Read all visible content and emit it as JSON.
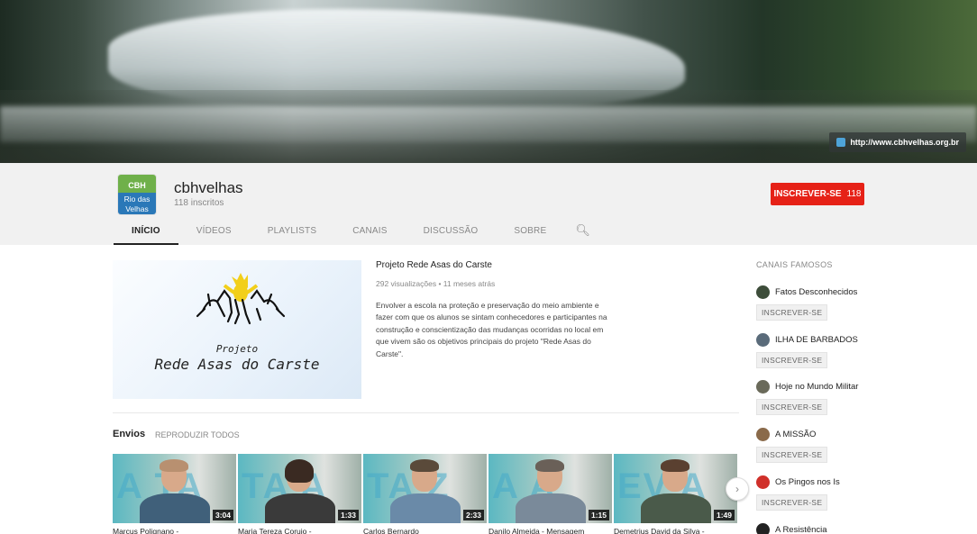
{
  "banner": {
    "link_text": "http://www.cbhvelhas.org.br"
  },
  "channel": {
    "name": "cbhvelhas",
    "subscribers": "118 inscritos",
    "avatar_text_top": "CBH",
    "avatar_text_bottom_1": "Rio das",
    "avatar_text_bottom_2": "Velhas",
    "subscribe_label": "INSCREVER-SE",
    "subscribe_count": "118"
  },
  "tabs": [
    {
      "label": "INÍCIO"
    },
    {
      "label": "VÍDEOS"
    },
    {
      "label": "PLAYLISTS"
    },
    {
      "label": "CANAIS"
    },
    {
      "label": "DISCUSSÃO"
    },
    {
      "label": "SOBRE"
    }
  ],
  "featured": {
    "thumb_line1": "Projeto",
    "thumb_line2": "Rede Asas do Carste",
    "title": "Projeto Rede Asas do Carste",
    "meta": "292 visualizações • 11 meses atrás",
    "description": "Envolver a escola na proteção e preservação do meio ambiente e fazer com que os alunos se sintam conhecedores e participantes na construção e conscientização das mudanças ocorridas no local em que vivem são os objetivos principais do projeto \"Rede Asas do Carste\"."
  },
  "uploads": {
    "title": "Envios",
    "play_all": "REPRODUZIR TODOS",
    "videos": [
      {
        "duration": "3:04",
        "caption": "Marcus Polignano -"
      },
      {
        "duration": "1:33",
        "caption": "Maria Tereza Corujo -"
      },
      {
        "duration": "2:33",
        "caption": "Carlos Bernardo"
      },
      {
        "duration": "1:15",
        "caption": "Danilo Almeida - Mensagem"
      },
      {
        "duration": "1:49",
        "caption": "Demetrius David da Silva -"
      }
    ]
  },
  "sidebar": {
    "title": "CANAIS FAMOSOS",
    "button_label": "INSCREVER-SE",
    "channels": [
      {
        "name": "Fatos Desconhecidos"
      },
      {
        "name": "ILHA DE BARBADOS"
      },
      {
        "name": "Hoje no Mundo Militar"
      },
      {
        "name": "A MISSÃO"
      },
      {
        "name": "Os Pingos nos Is"
      },
      {
        "name": "A Resistência"
      }
    ]
  },
  "colors": {
    "subscribe": "#e62117",
    "header_bg": "#f1f1f1"
  }
}
